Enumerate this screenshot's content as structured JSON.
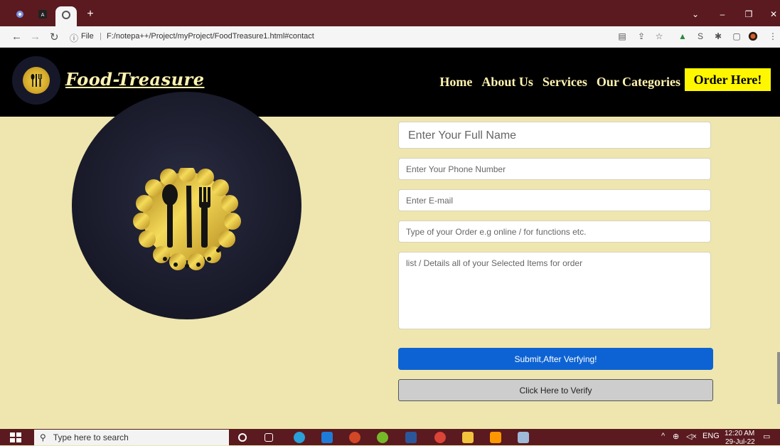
{
  "browser": {
    "new_tab_label": "+",
    "url": "F:/notepa++/Project/myProject/FoodTreasure1.html#contact",
    "file_label": "File",
    "minimize": "–",
    "maximize": "❐",
    "close": "✕",
    "chevron": "⌄"
  },
  "header": {
    "brand": "Food-Treasure",
    "nav": [
      "Home",
      "About Us",
      "Services",
      "Our Categories"
    ],
    "order_button": "Order Here!"
  },
  "form": {
    "name_placeholder": "Enter Your Full Name",
    "phone_placeholder": "Enter Your Phone Number",
    "email_placeholder": "Enter E-mail",
    "type_placeholder": "Type of your Order e.g online / for functions etc.",
    "details_placeholder": "list / Details all of your Selected Items for order",
    "submit_label": "Submit,After Verfying!",
    "verify_label": "Click Here to Verify"
  },
  "taskbar": {
    "search_placeholder": "Type here to search",
    "language": "ENG",
    "time": "12:20 AM",
    "date": "29-Jul-22"
  },
  "colors": {
    "background": "#eee6ae",
    "header": "#000000",
    "brand_text": "#fff3b0",
    "order_button": "#fff700",
    "submit_button": "#0d63d3",
    "chrome_titlebar": "#5a1a1f"
  }
}
